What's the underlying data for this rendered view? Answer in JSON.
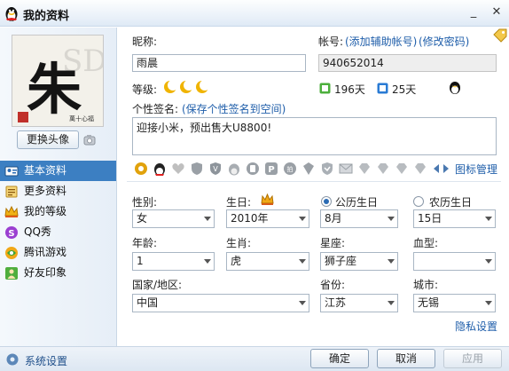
{
  "window": {
    "title": "我的资料"
  },
  "left": {
    "avatar_char": "朱",
    "avatar_small_text": "萬十心福",
    "change_avatar_label": "更换头像",
    "nav": [
      {
        "label": "基本资料",
        "icon": "user-card-icon",
        "selected": true
      },
      {
        "label": "更多资料",
        "icon": "document-icon",
        "selected": false
      },
      {
        "label": "我的等级",
        "icon": "crown-icon",
        "selected": false
      },
      {
        "label": "QQ秀",
        "icon": "qq-show-icon",
        "selected": false
      },
      {
        "label": "腾讯游戏",
        "icon": "game-icon",
        "selected": false
      },
      {
        "label": "好友印象",
        "icon": "friend-impression-icon",
        "selected": false
      }
    ]
  },
  "profile": {
    "nickname_label": "昵称:",
    "nickname_value": "雨晨",
    "account_label": "帐号:",
    "add_account_link": "(添加辅助帐号)",
    "change_pwd_link": "(修改密码)",
    "account_value": "940652014",
    "level_label": "等级:",
    "level_icons": [
      "moon-icon",
      "moon-icon",
      "moon-icon"
    ],
    "active_days": "196天",
    "days_to_upgrade": "25天",
    "signature_label": "个性签名:",
    "signature_link": "(保存个性签名到空间)",
    "signature_value": "迎接小米，预出售大U8800!",
    "icon_manage_link": "图标管理"
  },
  "details": {
    "gender_label": "性别:",
    "gender_value": "女",
    "birthday_label": "生日:",
    "solar_label": "公历生日",
    "lunar_label": "农历生日",
    "calendar_selected": "solar",
    "year_value": "2010年",
    "month_value": "8月",
    "day_value": "15日",
    "age_label": "年龄:",
    "age_value": "1",
    "zodiac_label": "生肖:",
    "zodiac_value": "虎",
    "constellation_label": "星座:",
    "constellation_value": "狮子座",
    "blood_label": "血型:",
    "blood_value": "",
    "country_label": "国家/地区:",
    "country_value": "中国",
    "province_label": "省份:",
    "province_value": "江苏",
    "city_label": "城市:",
    "city_value": "无锡",
    "privacy_link": "隐私设置"
  },
  "footer": {
    "settings_label": "系统设置",
    "ok_label": "确定",
    "cancel_label": "取消",
    "apply_label": "应用"
  },
  "colors": {
    "accent": "#3c7fc2",
    "link": "#1f5eaa",
    "title_bg": "#dfeaf6",
    "moon": "#e8a800"
  }
}
